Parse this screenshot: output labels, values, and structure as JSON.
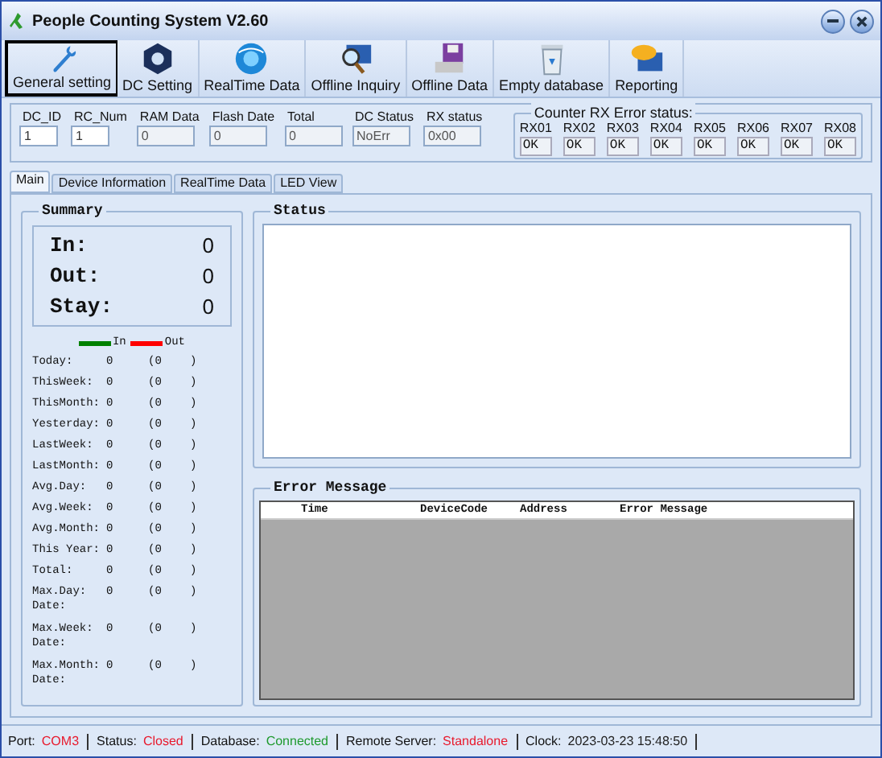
{
  "window": {
    "title": "People Counting System  V2.60"
  },
  "toolbar": [
    {
      "label": "General setting",
      "selected": true
    },
    {
      "label": "DC Setting",
      "selected": false
    },
    {
      "label": "RealTime Data",
      "selected": false
    },
    {
      "label": "Offline Inquiry",
      "selected": false
    },
    {
      "label": "Offline Data",
      "selected": false
    },
    {
      "label": "Empty database",
      "selected": false
    },
    {
      "label": "Reporting",
      "selected": false
    }
  ],
  "fields": [
    {
      "label": "DC_ID",
      "value": "1",
      "disabled": false
    },
    {
      "label": "RC_Num",
      "value": "1",
      "disabled": false
    },
    {
      "label": "RAM Data",
      "value": "0",
      "disabled": true
    },
    {
      "label": "Flash Date",
      "value": "0",
      "disabled": true
    },
    {
      "label": "Total",
      "value": "0",
      "disabled": true
    },
    {
      "label": "DC Status",
      "value": "NoErr",
      "disabled": true
    },
    {
      "label": "RX status",
      "value": "0x00",
      "disabled": true
    }
  ],
  "rx_error": {
    "title": "Counter RX Error status:",
    "channels": [
      {
        "label": "RX01",
        "value": "OK"
      },
      {
        "label": "RX02",
        "value": "OK"
      },
      {
        "label": "RX03",
        "value": "OK"
      },
      {
        "label": "RX04",
        "value": "OK"
      },
      {
        "label": "RX05",
        "value": "OK"
      },
      {
        "label": "RX06",
        "value": "OK"
      },
      {
        "label": "RX07",
        "value": "OK"
      },
      {
        "label": "RX08",
        "value": "OK"
      }
    ]
  },
  "tabs": [
    {
      "label": "Main",
      "selected": true
    },
    {
      "label": "Device Information",
      "selected": false
    },
    {
      "label": "RealTime Data",
      "selected": false
    },
    {
      "label": "LED View",
      "selected": false
    }
  ],
  "summary": {
    "title": "Summary",
    "totals": [
      {
        "label": "In:",
        "value": "0"
      },
      {
        "label": "Out:",
        "value": "0"
      },
      {
        "label": "Stay:",
        "value": "0"
      }
    ],
    "legend": [
      {
        "label": "In",
        "color": "#008000"
      },
      {
        "label": "Out",
        "color": "#ff0000"
      }
    ],
    "stats": [
      {
        "label": "Today:",
        "value": "0",
        "out": "(0",
        "close": ")"
      },
      {
        "label": "ThisWeek:",
        "value": "0",
        "out": "(0",
        "close": ")"
      },
      {
        "label": "ThisMonth:",
        "value": "0",
        "out": "(0",
        "close": ")"
      },
      {
        "label": "Yesterday:",
        "value": "0",
        "out": "(0",
        "close": ")"
      },
      {
        "label": "LastWeek:",
        "value": "0",
        "out": "(0",
        "close": ")"
      },
      {
        "label": "LastMonth:",
        "value": "0",
        "out": "(0",
        "close": ")"
      },
      {
        "label": "Avg.Day:",
        "value": "0",
        "out": "(0",
        "close": ")"
      },
      {
        "label": "Avg.Week:",
        "value": "0",
        "out": "(0",
        "close": ")"
      },
      {
        "label": "Avg.Month:",
        "value": "0",
        "out": "(0",
        "close": ")"
      },
      {
        "label": "This Year:",
        "value": "0",
        "out": "(0",
        "close": ")"
      },
      {
        "label": "Total:",
        "value": "0",
        "out": "(0",
        "close": ")"
      },
      {
        "label": "Max.Day:",
        "value": "0",
        "out": "(0",
        "close": ")",
        "date": "Date:"
      },
      {
        "label": "Max.Week:",
        "value": "0",
        "out": "(0",
        "close": ")",
        "date": "Date:"
      },
      {
        "label": "Max.Month:",
        "value": "0",
        "out": "(0",
        "close": ")",
        "date": "Date:"
      }
    ]
  },
  "status_panel": {
    "title": "Status"
  },
  "error_panel": {
    "title": "Error Message",
    "columns": [
      "Time",
      "DeviceCode",
      "Address",
      "Error Message"
    ]
  },
  "status_bar": [
    {
      "label": "Port:",
      "value": "COM3",
      "color": "#e8192c"
    },
    {
      "label": "Status:",
      "value": "Closed",
      "color": "#e8192c"
    },
    {
      "label": "Database:",
      "value": "Connected",
      "color": "#1f9a2e"
    },
    {
      "label": "Remote Server:",
      "value": "Standalone",
      "color": "#e8192c"
    },
    {
      "label": "Clock:",
      "value": "2023-03-23 15:48:50",
      "color": "#222222"
    }
  ]
}
